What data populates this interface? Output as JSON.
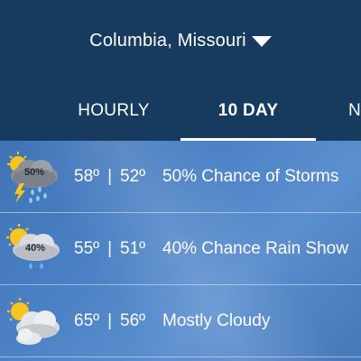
{
  "location": {
    "name": "Columbia, Missouri"
  },
  "tabs": {
    "prev": "/",
    "hourly": "HOURLY",
    "tenday": "10 DAY",
    "next": "N"
  },
  "forecast": [
    {
      "icon": "thunderstorm-cloud-icon",
      "precip": "50%",
      "high": "58º",
      "low": "52º",
      "condition": "50% Chance of Storms"
    },
    {
      "icon": "rain-cloud-sun-icon",
      "precip": "40%",
      "high": "55º",
      "low": "51º",
      "condition": "40% Chance Rain Show"
    },
    {
      "icon": "mostly-cloudy-icon",
      "high": "65º",
      "low": "56º",
      "condition": "Mostly Cloudy"
    }
  ],
  "colors": {
    "header": "#173b5f",
    "list_bg": "#4a80c4",
    "text": "#ffffff"
  }
}
